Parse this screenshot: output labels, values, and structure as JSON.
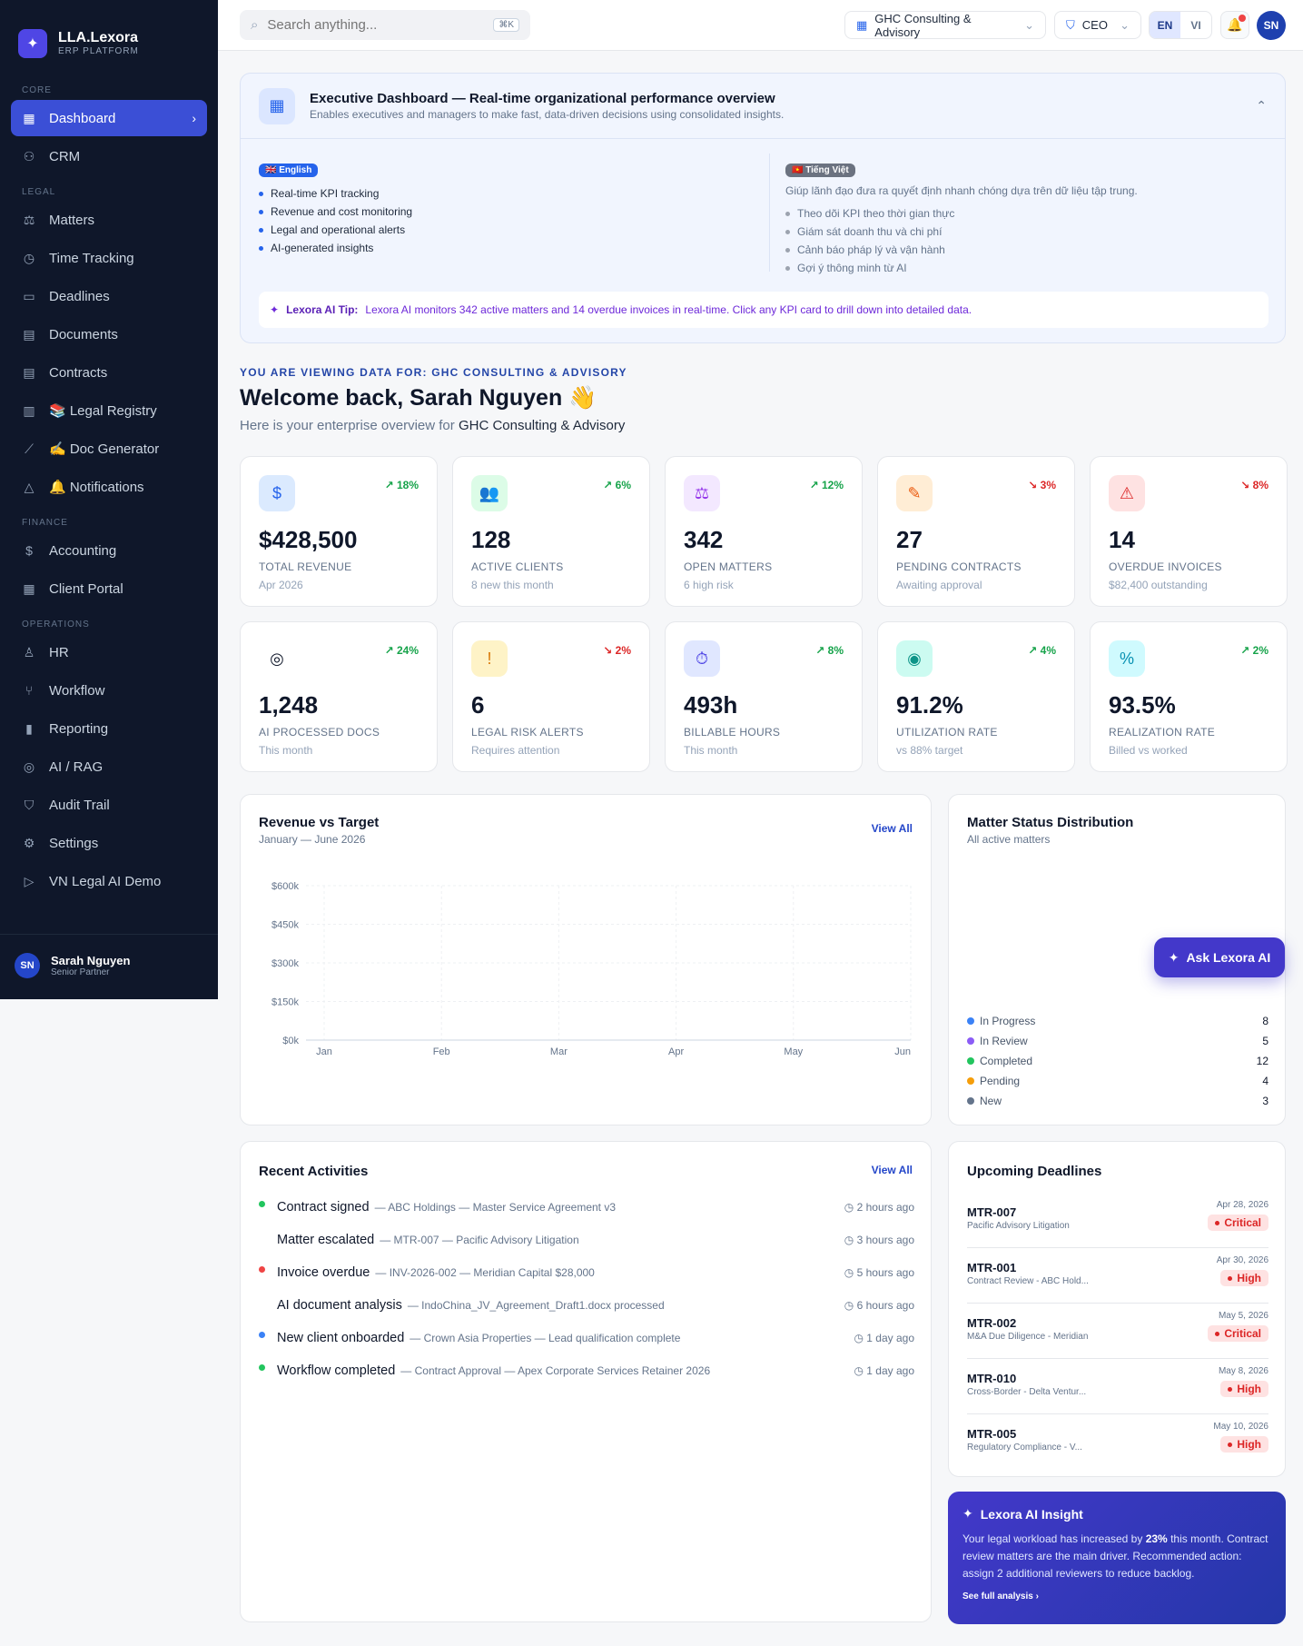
{
  "brand": {
    "name": "LLA.Lexora",
    "sub": "ERP PLATFORM"
  },
  "sidebar": {
    "core_label": "CORE",
    "core": [
      {
        "label": "Dashboard",
        "icon": "grid-icon"
      },
      {
        "label": "CRM",
        "icon": "users-icon"
      }
    ],
    "legal_label": "LEGAL",
    "legal": [
      {
        "label": "Matters",
        "icon": "scale-icon"
      },
      {
        "label": "Time Tracking",
        "icon": "clock-icon"
      },
      {
        "label": "Deadlines",
        "icon": "calendar-icon"
      },
      {
        "label": "Documents",
        "icon": "file-icon"
      },
      {
        "label": "Contracts",
        "icon": "contract-icon"
      },
      {
        "label": "📚 Legal Registry",
        "icon": "book-icon"
      },
      {
        "label": "✍️ Doc Generator",
        "icon": "wand-icon"
      },
      {
        "label": "🔔 Notifications",
        "icon": "bell-icon"
      }
    ],
    "finance_label": "FINANCE",
    "finance": [
      {
        "label": "Accounting",
        "icon": "dollar-icon"
      },
      {
        "label": "Client Portal",
        "icon": "building-icon"
      }
    ],
    "ops_label": "OPERATIONS",
    "ops": [
      {
        "label": "HR",
        "icon": "user-icon"
      },
      {
        "label": "Workflow",
        "icon": "workflow-icon"
      },
      {
        "label": "Reporting",
        "icon": "bar-chart-icon"
      },
      {
        "label": "AI / RAG",
        "icon": "brain-icon"
      },
      {
        "label": "Audit Trail",
        "icon": "shield-icon"
      },
      {
        "label": "Settings",
        "icon": "gear-icon"
      },
      {
        "label": "VN Legal AI Demo",
        "icon": "play-icon"
      }
    ]
  },
  "user": {
    "initials": "SN",
    "name": "Sarah Nguyen",
    "role": "Senior Partner"
  },
  "topbar": {
    "search_placeholder": "Search anything...",
    "shortcut": "⌘K",
    "company": "GHC Consulting & Advisory",
    "role": "CEO",
    "lang_en": "EN",
    "lang_vi": "VI",
    "avatar": "SN"
  },
  "exec": {
    "title": "Executive Dashboard — Real-time organizational performance overview",
    "sub": "Enables executives and managers to make fast, data-driven decisions using consolidated insights.",
    "en_badge": "🇬🇧 English",
    "en_items": [
      "Real-time KPI tracking",
      "Revenue and cost monitoring",
      "Legal and operational alerts",
      "AI-generated insights"
    ],
    "vi_badge": "🇻🇳 Tiếng Việt",
    "vi_intro": "Giúp lãnh đạo đưa ra quyết định nhanh chóng dựa trên dữ liệu tập trung.",
    "vi_items": [
      "Theo dõi KPI theo thời gian thực",
      "Giám sát doanh thu và chi phí",
      "Cảnh báo pháp lý và vận hành",
      "Gợi ý thông minh từ AI"
    ],
    "tip_label": "Lexora AI Tip:",
    "tip_text": "Lexora AI monitors 342 active matters and 14 overdue invoices in real-time. Click any KPI card to drill down into detailed data."
  },
  "welcome": {
    "viewing": "YOU ARE VIEWING DATA FOR: GHC CONSULTING & ADVISORY",
    "title": "Welcome back, Sarah Nguyen 👋",
    "pre": "Here is your enterprise overview for",
    "company": "GHC Consulting & Advisory"
  },
  "kpis": [
    {
      "value": "$428,500",
      "label": "TOTAL REVENUE",
      "sub": "Apr 2026",
      "trend": "↗ 18%",
      "dir": "up",
      "icon": "$",
      "bg": "#dbeafe",
      "fg": "#2563eb"
    },
    {
      "value": "128",
      "label": "ACTIVE CLIENTS",
      "sub": "8 new this month",
      "trend": "↗ 6%",
      "dir": "up",
      "icon": "👥",
      "bg": "#dcfce7",
      "fg": "#16a34a"
    },
    {
      "value": "342",
      "label": "OPEN MATTERS",
      "sub": "6 high risk",
      "trend": "↗ 12%",
      "dir": "up",
      "icon": "⚖",
      "bg": "#f3e8ff",
      "fg": "#9333ea"
    },
    {
      "value": "27",
      "label": "PENDING CONTRACTS",
      "sub": "Awaiting approval",
      "trend": "↘ 3%",
      "dir": "down",
      "icon": "✎",
      "bg": "#ffedd5",
      "fg": "#ea580c"
    },
    {
      "value": "14",
      "label": "OVERDUE INVOICES",
      "sub": "$82,400 outstanding",
      "trend": "↘ 8%",
      "dir": "down",
      "icon": "⚠",
      "bg": "#fee2e2",
      "fg": "#dc2626"
    },
    {
      "value": "1,248",
      "label": "AI PROCESSED DOCS",
      "sub": "This month",
      "trend": "↗ 24%",
      "dir": "up",
      "icon": "◎",
      "bg": "#ffffff",
      "fg": "#0f172a"
    },
    {
      "value": "6",
      "label": "LEGAL RISK ALERTS",
      "sub": "Requires attention",
      "trend": "↘ 2%",
      "dir": "down",
      "icon": "!",
      "bg": "#fef3c7",
      "fg": "#d97706"
    },
    {
      "value": "493h",
      "label": "BILLABLE HOURS",
      "sub": "This month",
      "trend": "↗ 8%",
      "dir": "up",
      "icon": "⏱",
      "bg": "#e0e7ff",
      "fg": "#4f46e5"
    },
    {
      "value": "91.2%",
      "label": "UTILIZATION RATE",
      "sub": "vs 88% target",
      "trend": "↗ 4%",
      "dir": "up",
      "icon": "◉",
      "bg": "#ccfbf1",
      "fg": "#0d9488"
    },
    {
      "value": "93.5%",
      "label": "REALIZATION RATE",
      "sub": "Billed vs worked",
      "trend": "↗ 2%",
      "dir": "up",
      "icon": "%",
      "bg": "#cffafe",
      "fg": "#0891b2"
    }
  ],
  "revenue_chart": {
    "title": "Revenue vs Target",
    "sub": "January — June 2026",
    "view_all": "View All"
  },
  "chart_data": {
    "type": "line",
    "title": "Revenue vs Target",
    "categories": [
      "Jan",
      "Feb",
      "Mar",
      "Apr",
      "May",
      "Jun"
    ],
    "yticks": [
      "$600k",
      "$450k",
      "$300k",
      "$150k",
      "$0k"
    ],
    "ylim": [
      0,
      600000
    ],
    "grid": true,
    "series": []
  },
  "matter_status": {
    "title": "Matter Status Distribution",
    "sub": "All active matters",
    "items": [
      {
        "label": "In Progress",
        "count": "8",
        "color": "#3b82f6"
      },
      {
        "label": "In Review",
        "count": "5",
        "color": "#8b5cf6"
      },
      {
        "label": "Completed",
        "count": "12",
        "color": "#22c55e"
      },
      {
        "label": "Pending",
        "count": "4",
        "color": "#f59e0b"
      },
      {
        "label": "New",
        "count": "3",
        "color": "#64748b"
      }
    ]
  },
  "ask": {
    "label": "Ask Lexora AI"
  },
  "activities": {
    "title": "Recent Activities",
    "view_all": "View All",
    "items": [
      {
        "title": "Contract signed",
        "detail": "— ABC Holdings — Master Service Agreement v3",
        "time": "2 hours ago",
        "dot": "#22c55e"
      },
      {
        "title": "Matter escalated",
        "detail": "— MTR-007 — Pacific Advisory Litigation",
        "time": "3 hours ago",
        "dot": "transparent"
      },
      {
        "title": "Invoice overdue",
        "detail": "— INV-2026-002 — Meridian Capital $28,000",
        "time": "5 hours ago",
        "dot": "#ef4444"
      },
      {
        "title": "AI document analysis",
        "detail": "— IndoChina_JV_Agreement_Draft1.docx processed",
        "time": "6 hours ago",
        "dot": "transparent"
      },
      {
        "title": "New client onboarded",
        "detail": "— Crown Asia Properties — Lead qualification complete",
        "time": "1 day ago",
        "dot": "#3b82f6"
      },
      {
        "title": "Workflow completed",
        "detail": "— Contract Approval — Apex Corporate Services Retainer 2026",
        "time": "1 day ago",
        "dot": "#22c55e"
      }
    ]
  },
  "deadlines": {
    "title": "Upcoming Deadlines",
    "items": [
      {
        "id": "MTR-007",
        "desc": "Pacific Advisory Litigation",
        "date": "Apr 28, 2026",
        "priority": "Critical"
      },
      {
        "id": "MTR-001",
        "desc": "Contract Review - ABC Hold...",
        "date": "Apr 30, 2026",
        "priority": "High"
      },
      {
        "id": "MTR-002",
        "desc": "M&A Due Diligence - Meridian",
        "date": "May 5, 2026",
        "priority": "Critical"
      },
      {
        "id": "MTR-010",
        "desc": "Cross-Border - Delta Ventur...",
        "date": "May 8, 2026",
        "priority": "High"
      },
      {
        "id": "MTR-005",
        "desc": "Regulatory Compliance - V...",
        "date": "May 10, 2026",
        "priority": "High"
      }
    ]
  },
  "insight": {
    "title": "Lexora AI Insight",
    "pre": "Your legal workload has increased by",
    "pct": "23%",
    "post": "this month. Contract review matters are the main driver. Recommended action: assign 2 additional reviewers to reduce backlog.",
    "link": "See full analysis  ›"
  }
}
